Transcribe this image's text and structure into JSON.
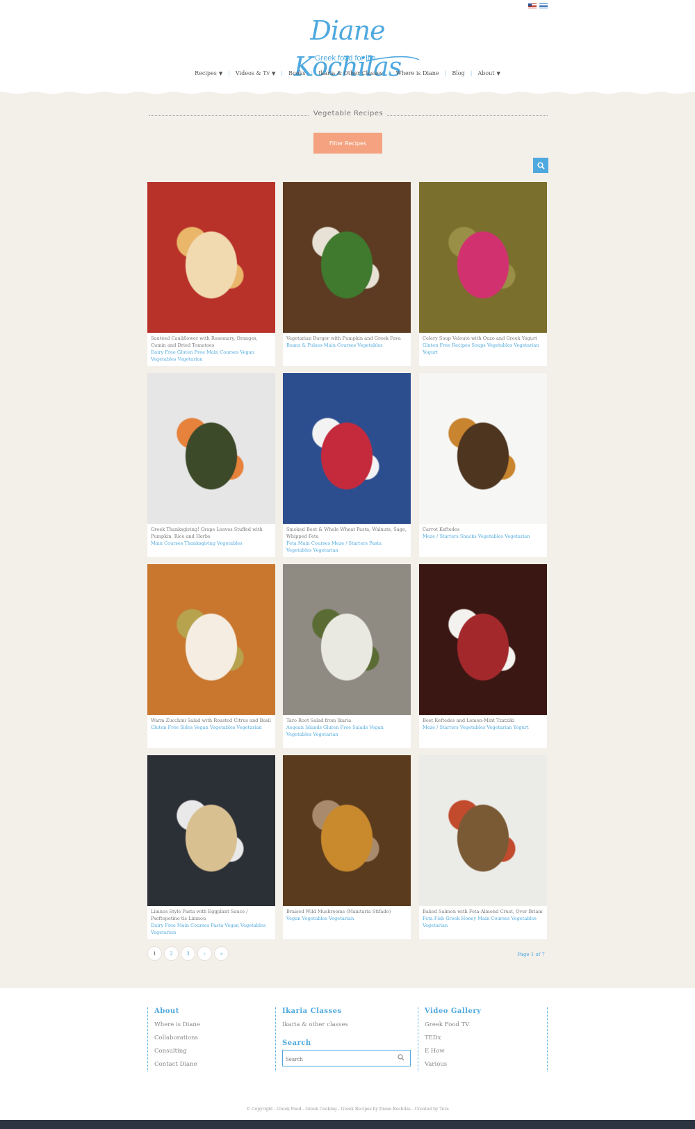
{
  "header": {
    "logo_script": "Diane Kochilas",
    "logo_tagline": "Greek food for life",
    "flags": [
      "us-flag-icon",
      "greek-flag-icon"
    ]
  },
  "nav": {
    "items": [
      {
        "label": "Recipes",
        "caret": "▼"
      },
      {
        "label": "Videos & Tv",
        "caret": "▼"
      },
      {
        "label": "Books",
        "caret": ""
      },
      {
        "label": "Ikaria & Other Classes",
        "caret": ""
      },
      {
        "label": "Where is Diane",
        "caret": ""
      },
      {
        "label": "Blog",
        "caret": ""
      },
      {
        "label": "About",
        "caret": "▼"
      }
    ],
    "separator": "|"
  },
  "main": {
    "section_title": "Vegetable Recipes",
    "filter_button": "Filter Recipes",
    "search_icon": "search-icon"
  },
  "cards": [
    {
      "title": "Sautéed Cauliflower with Rosemary, Oranges, Cumin and Dried Tomatoes",
      "tags": "Dairy Free Gluten Free Main Courses Vegan Vegetables Vegetarian",
      "palette": [
        "#b8322a",
        "#f1d9b0",
        "#e9b66a"
      ]
    },
    {
      "title": "Vegetarian Burger with Pumpkin and Greek Fava",
      "tags": "Beans & Pulses Main Courses Vegetables",
      "palette": [
        "#5c3b22",
        "#3f7a2e",
        "#e8e1d5"
      ]
    },
    {
      "title": "Celery Soup Velouté with Ouzo and Greek Yogurt",
      "tags": "Gluten Free Recipes Soups Vegetables Vegetarian Yogurt",
      "palette": [
        "#7b6f2d",
        "#d1316f",
        "#9a8f46"
      ]
    },
    {
      "title": "Greek Thanksgiving! Grape Leaves Stuffed with Pumpkin, Rice and Herbs",
      "tags": "Main Courses Thanksgiving Vegetables",
      "palette": [
        "#e6e6e6",
        "#3c4a2a",
        "#e6823b"
      ]
    },
    {
      "title": "Smoked Beet & Whole Wheat Pasta, Walnuts, Sage, Whipped Feta",
      "tags": "Feta Main Courses Meze / Starters Pasta Vegetables Vegetarian",
      "palette": [
        "#2c4e8f",
        "#c52a3c",
        "#f3f3f3"
      ]
    },
    {
      "title": "Carrot Keftedes",
      "tags": "Meze / Starters Snacks Vegetables Vegetarian",
      "palette": [
        "#f6f6f4",
        "#4e3520",
        "#c8842e"
      ]
    },
    {
      "title": "Warm Zucchini Salad with Roasted Citrus and Basil",
      "tags": "Gluten Free Sides Vegan Vegetables Vegetarian",
      "palette": [
        "#c9772f",
        "#f5ede1",
        "#b7a24e"
      ]
    },
    {
      "title": "Taro Root Salad from Ikaria",
      "tags": "Aegean Islands Gluten Free Salads Vegan Vegetables Vegetarian",
      "palette": [
        "#8f8a82",
        "#e9e9e2",
        "#5a6b34"
      ]
    },
    {
      "title": "Beet Keftedes and Lemon-Mint Tzatziki",
      "tags": "Meze / Starters Vegetables Vegetarian Yogurt",
      "palette": [
        "#3b1713",
        "#a3282c",
        "#f3f2ee"
      ]
    },
    {
      "title": "Limnos Style Pasta with Eggplant Sauce / Pseftopetino tis Limnou",
      "tags": "Dairy Free Main Courses Pasta Vegan Vegetables Vegetarian",
      "palette": [
        "#2b2f36",
        "#d9c091",
        "#e9e9e9"
      ]
    },
    {
      "title": "Braised Wild Mushrooms (Manitaria Stifado)",
      "tags": "Vegan Vegetables Vegetarian",
      "palette": [
        "#5b3b1d",
        "#c98a2e",
        "#a88b6c"
      ]
    },
    {
      "title": "Baked Salmon with Feta-Almond Crust, Over Briam",
      "tags": "Feta Fish Greek Honey Main Courses Vegetables Vegetarian",
      "palette": [
        "#ebebe8",
        "#7a5a35",
        "#c24a2d"
      ]
    }
  ],
  "pagination": {
    "pages": [
      "1",
      "2",
      "3",
      "›",
      "»"
    ],
    "page_of": "Page 1 of 7"
  },
  "footer": {
    "col1": {
      "heading": "About",
      "links": [
        "Where is Diane",
        "Collaborations",
        "Consulting",
        "Contact Diane"
      ]
    },
    "col2": {
      "heading": "Ikaria Classes",
      "links": [
        "Ikaria & other classes"
      ],
      "search_heading": "Search",
      "search_placeholder": "Search"
    },
    "col3": {
      "heading": "Video Gallery",
      "links": [
        "Greek Food TV",
        "TEDx",
        "E How",
        "Various"
      ]
    },
    "copyright": "© Copyright - Greek Food - Greek Cooking - Greek Recipes by Diane Kochilas - Created by Tera"
  }
}
